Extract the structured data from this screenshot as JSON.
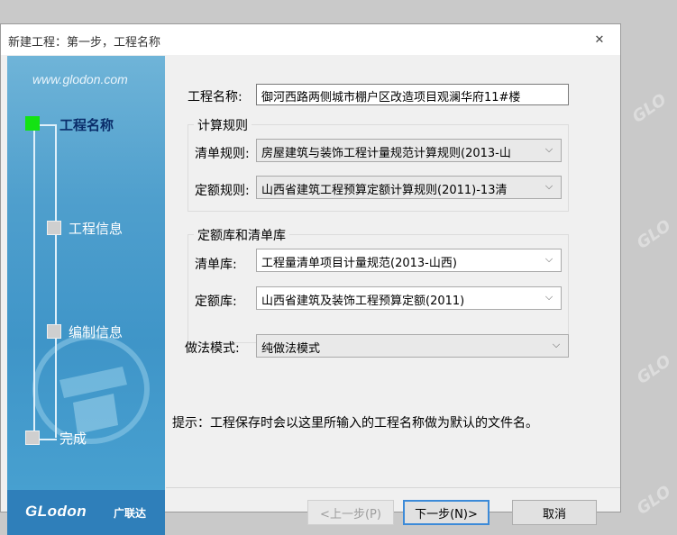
{
  "window": {
    "title": "新建工程：第一步，工程名称",
    "close_glyph": "✕"
  },
  "sidebar": {
    "website": "www.glodon.com",
    "steps": [
      {
        "label": "工程名称",
        "active": true
      },
      {
        "label": "工程信息",
        "active": false
      },
      {
        "label": "编制信息",
        "active": false
      },
      {
        "label": "完成",
        "active": false
      }
    ],
    "brand_logo": "GLodon",
    "brand_cn": "广联达"
  },
  "form": {
    "project_name_label": "工程名称:",
    "project_name_value": "御河西路两侧城市棚户区改造项目观澜华府11#楼",
    "calc_rules": {
      "title": "计算规则",
      "bill_rule_label": "清单规则:",
      "bill_rule_value": "房屋建筑与装饰工程计量规范计算规则(2013-山",
      "quota_rule_label": "定额规则:",
      "quota_rule_value": "山西省建筑工程预算定额计算规则(2011)-13清"
    },
    "libraries": {
      "title": "定额库和清单库",
      "bill_lib_label": "清单库:",
      "bill_lib_value": "工程量清单项目计量规范(2013-山西)",
      "quota_lib_label": "定额库:",
      "quota_lib_value": "山西省建筑及装饰工程预算定额(2011)"
    },
    "method_label": "做法模式:",
    "method_value": "纯做法模式",
    "hint": "提示：工程保存时会以这里所输入的工程名称做为默认的文件名。"
  },
  "buttons": {
    "prev": "<上一步(P)",
    "next": "下一步(N)>",
    "cancel": "取消"
  },
  "icons": {
    "dropdown": "⌵"
  },
  "watermark": "GLO",
  "colors": {
    "active_step": "#13e313",
    "sidebar": "#4f9fcd"
  }
}
